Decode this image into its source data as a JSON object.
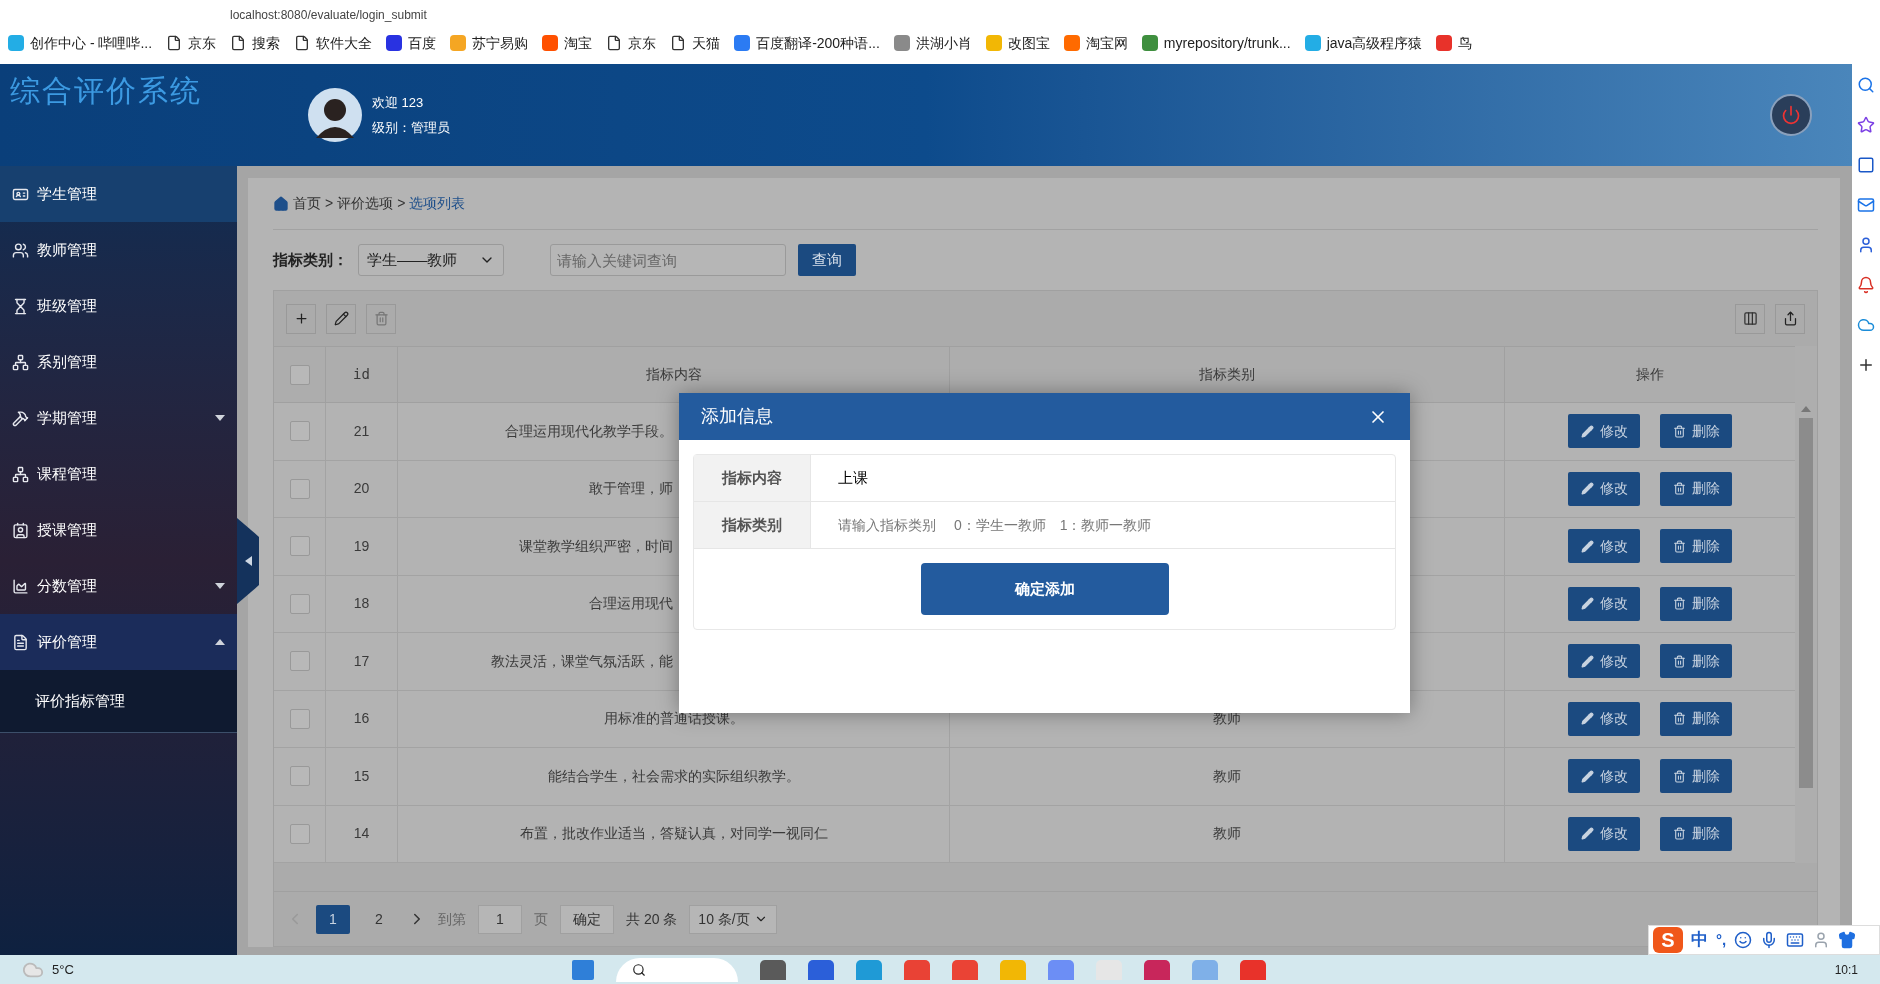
{
  "browser": {
    "url": "localhost:8080/evaluate/login_submit",
    "bookmarks": [
      {
        "label": "创作中心 - 哔哩哔...",
        "kind": "logo",
        "color": "#23ade5"
      },
      {
        "label": "京东",
        "kind": "page"
      },
      {
        "label": "搜索",
        "kind": "page"
      },
      {
        "label": "软件大全",
        "kind": "page"
      },
      {
        "label": "百度",
        "kind": "logo",
        "color": "#2932e1"
      },
      {
        "label": "苏宁易购",
        "kind": "logo",
        "color": "#f5a623"
      },
      {
        "label": "淘宝",
        "kind": "logo",
        "color": "#ff5000"
      },
      {
        "label": "京东",
        "kind": "page"
      },
      {
        "label": "天猫",
        "kind": "page"
      },
      {
        "label": "百度翻译-200种语...",
        "kind": "logo",
        "color": "#2b7bf3"
      },
      {
        "label": "洪湖小肖",
        "kind": "logo",
        "color": "#8a8a8a"
      },
      {
        "label": "改图宝",
        "kind": "logo",
        "color": "#f2b705"
      },
      {
        "label": "淘宝网",
        "kind": "logo",
        "color": "#ff6a00"
      },
      {
        "label": "myrepository/trunk...",
        "kind": "logo",
        "color": "#3f8f3f"
      },
      {
        "label": "java高级程序猿",
        "kind": "logo",
        "color": "#23ade5"
      },
      {
        "label": "鸟",
        "kind": "logo",
        "color": "#e8322a"
      }
    ]
  },
  "header": {
    "title": "综合评价系统",
    "welcome": "欢迎 123",
    "role": "级别：管理员"
  },
  "sidebar": {
    "items": [
      {
        "label": "学生管理",
        "hovered": true
      },
      {
        "label": "教师管理",
        "hovered": false
      },
      {
        "label": "班级管理",
        "hovered": false
      },
      {
        "label": "系别管理",
        "hovered": false
      },
      {
        "label": "学期管理",
        "hovered": false,
        "expanded": false
      },
      {
        "label": "课程管理",
        "hovered": false
      },
      {
        "label": "授课管理",
        "hovered": false
      },
      {
        "label": "分数管理",
        "hovered": false,
        "expanded": false
      },
      {
        "label": "评价管理",
        "hovered": false,
        "expanded": true,
        "children": [
          {
            "label": "评价指标管理"
          }
        ]
      }
    ]
  },
  "breadcrumb": {
    "items": [
      "首页",
      "评价选项",
      "选项列表"
    ],
    "separator": ">"
  },
  "filter": {
    "label": "指标类别：",
    "category": "学生——教师",
    "search_placeholder": "请输入关键词查询",
    "search_button": "查询"
  },
  "table": {
    "select_all": false,
    "columns": [
      "id",
      "指标内容",
      "指标类别",
      "操作"
    ],
    "rows": [
      {
        "id": "21",
        "content": "合理运用现代化教学手段。",
        "checked": false,
        "edit": "修改",
        "delete": "删除"
      },
      {
        "id": "20",
        "content": "敢于管理，师",
        "checked": false,
        "edit": "修改",
        "delete": "删除"
      },
      {
        "id": "19",
        "content": "课堂教学组织严密，时间",
        "checked": false,
        "edit": "修改",
        "delete": "删除"
      },
      {
        "id": "18",
        "content": "合理运用现代",
        "checked": false,
        "edit": "修改",
        "delete": "删除"
      },
      {
        "id": "17",
        "content": "教法灵活，课堂气氛活跃，能",
        "checked": false,
        "edit": "修改",
        "delete": "删除"
      },
      {
        "id": "16",
        "content": "用标准的普通话授课。",
        "category": "教师",
        "checked": false,
        "edit": "修改",
        "delete": "删除"
      },
      {
        "id": "15",
        "content": "能结合学生，社会需求的实际组织教学。",
        "category": "教师",
        "checked": false,
        "edit": "修改",
        "delete": "删除"
      },
      {
        "id": "14",
        "content": "布置，批改作业适当，答疑认真，对同学一视同仁",
        "category": "教师",
        "checked": false,
        "edit": "修改",
        "delete": "删除"
      }
    ]
  },
  "pagination": {
    "prev_disabled": true,
    "pages": [
      {
        "label": "1",
        "selected": true
      },
      {
        "label": "2",
        "selected": false
      }
    ],
    "goto_label": "到第",
    "page_input": "1",
    "page_suffix": "页",
    "confirm": "确定",
    "total": "共 20 条",
    "page_size": "10 条/页"
  },
  "dialog": {
    "title": "添加信息",
    "fields": [
      {
        "label": "指标内容",
        "value": "上课"
      },
      {
        "label": "指标类别",
        "placeholder": "请输入指标类别　 0：学生一教师　1：教师一教师"
      }
    ],
    "submit": "确定添加"
  },
  "ime": {
    "logo": "S",
    "mode": "中",
    "punct": "°,"
  },
  "taskbar": {
    "weather": "5°C",
    "time": "10:1"
  }
}
